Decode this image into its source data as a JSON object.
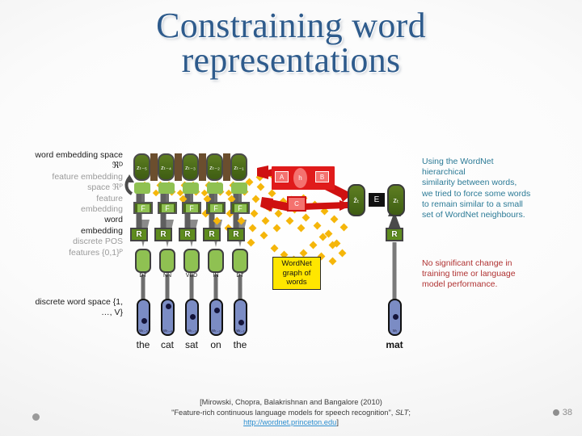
{
  "slide": {
    "title_line1": "Constraining word",
    "title_line2": "representations",
    "page_number": "38",
    "title_color": "#2e5b8c"
  },
  "left_labels": [
    {
      "text": "word embedding space",
      "tone": "dark"
    },
    {
      "text": "ℜᴰ",
      "tone": "dark"
    },
    {
      "text": "feature embedding",
      "tone": "gray"
    },
    {
      "text": "space ℜᴾ",
      "tone": "gray"
    },
    {
      "text": "feature",
      "tone": "gray"
    },
    {
      "text": "embedding",
      "tone": "gray"
    },
    {
      "text": "word",
      "tone": "dark"
    },
    {
      "text": "embedding",
      "tone": "dark"
    },
    {
      "text": "discrete POS",
      "tone": "gray"
    },
    {
      "text": "features {0,1}ᴾ",
      "tone": "gray"
    }
  ],
  "discrete_word_space": {
    "line1": "discrete word space {1,",
    "line2": "…, V}"
  },
  "diagram": {
    "z_nodes": [
      "zₜ₋₅",
      "zₜ₋₄",
      "zₜ₋₃",
      "zₜ₋₂",
      "zₜ₋₁"
    ],
    "f_label": "F",
    "r_label": "R",
    "pos_tags": [
      "DT",
      "NN",
      "VBD",
      "IN",
      "DT"
    ],
    "word_nodes": [
      "wₜ₋₅",
      "wₜ₋₄",
      "wₜ₋₃",
      "wₜ₋₂",
      "wₜ₋₁"
    ],
    "words": [
      "the",
      "cat",
      "sat",
      "on",
      "the"
    ],
    "target_word_node": "wₜ",
    "target_word": "mat",
    "target_r_label": "R",
    "red_block": {
      "a_label": "A",
      "h_label": "h",
      "b_label": "B",
      "c_label": "C",
      "color": "#e01b1b"
    },
    "z_hat_label": "ẑₜ",
    "e_label": "E",
    "z_t_label": "zₜ",
    "wordnet_box": {
      "line1": "WordNet",
      "line2": "graph of",
      "line3": "words",
      "bg": "#ffe600"
    }
  },
  "notes": {
    "blue": "Using the WordNet hierarchical similarity between words, we tried to force some words to remain similar to a small set of WordNet neighbours.",
    "blue_lines": [
      "Using the WordNet",
      "hierarchical",
      "similarity between words,",
      "we tried to force some words",
      "to remain similar to a small",
      "set of WordNet neighbours."
    ],
    "red_lines": [
      "No significant change in",
      "training time or language",
      "model performance."
    ],
    "blue_color": "#2b7a96",
    "red_color": "#b03232"
  },
  "footer": {
    "line1": "[Mirowski, Chopra, Balakrishnan and Bangalore (2010)",
    "line2_pre": "\"Feature-rich continuous language models for speech recognition\", ",
    "line2_italic": "SLT",
    "line2_post": ";",
    "link": "http://wordnet.princeton.edu",
    "line3_post": "]"
  }
}
